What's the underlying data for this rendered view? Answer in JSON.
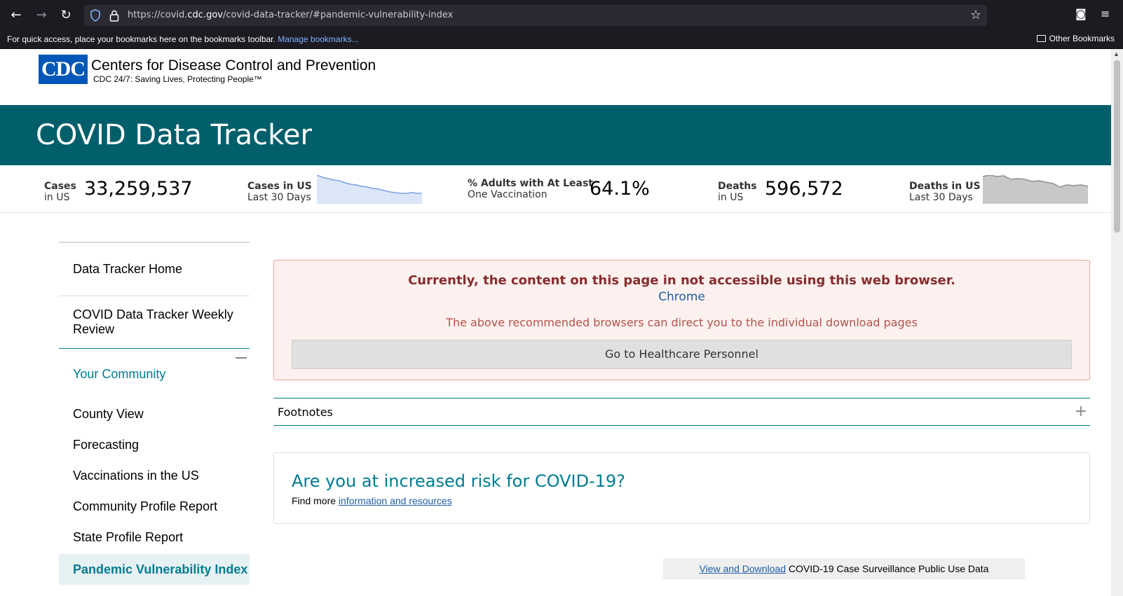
{
  "browser": {
    "url_prefix": "https://covid.",
    "url_domain": "cdc.gov",
    "url_path": "/covid-data-tracker/#pandemic-vulnerability-index",
    "bookmarks_hint": "For quick access, place your bookmarks here on the bookmarks toolbar.",
    "manage_bookmarks": "Manage bookmarks...",
    "other_bookmarks": "Other Bookmarks"
  },
  "header": {
    "logo_text": "CDC",
    "org_name": "Centers for Disease Control and Prevention",
    "tagline": "CDC 24/7: Saving Lives, Protecting People™",
    "page_title": "COVID Data Tracker"
  },
  "stats": {
    "cases": {
      "label1": "Cases",
      "label2": "in US",
      "value": "33,259,537"
    },
    "cases_trend": {
      "label1": "Cases in US",
      "label2": "Last 30 Days"
    },
    "vaccination": {
      "label1": "% Adults with At Least",
      "label2": "One Vaccination",
      "value": "64.1%"
    },
    "deaths": {
      "label1": "Deaths",
      "label2": "in US",
      "value": "596,572"
    },
    "deaths_trend": {
      "label1": "Deaths in US",
      "label2": "Last 30 Days"
    }
  },
  "sidebar": {
    "home": "Data Tracker Home",
    "weekly_review": "COVID Data Tracker Weekly Review",
    "community": "Your Community",
    "items": [
      "County View",
      "Forecasting",
      "Vaccinations in the US",
      "Community Profile Report",
      "State Profile Report"
    ],
    "active": "Pandemic Vulnerability Index"
  },
  "alert": {
    "title": "Currently, the content on this page in not accessible using this web browser.",
    "browser_link": "Chrome",
    "subtitle": "The above recommended browsers can direct you to the individual download pages",
    "button": "Go to Healthcare Personnel"
  },
  "footnotes": {
    "label": "Footnotes"
  },
  "risk": {
    "title": "Are you at increased risk for COVID-19?",
    "prefix": "Find more ",
    "link": "information and resources"
  },
  "download": {
    "link": "View and Download",
    "text": " COVID-19 Case Surveillance Public Use Data"
  },
  "colors": {
    "banner": "#005f6b",
    "accent": "#007c91",
    "cases_spark": "#dbe7f8",
    "deaths_spark": "#c8c8c8"
  }
}
